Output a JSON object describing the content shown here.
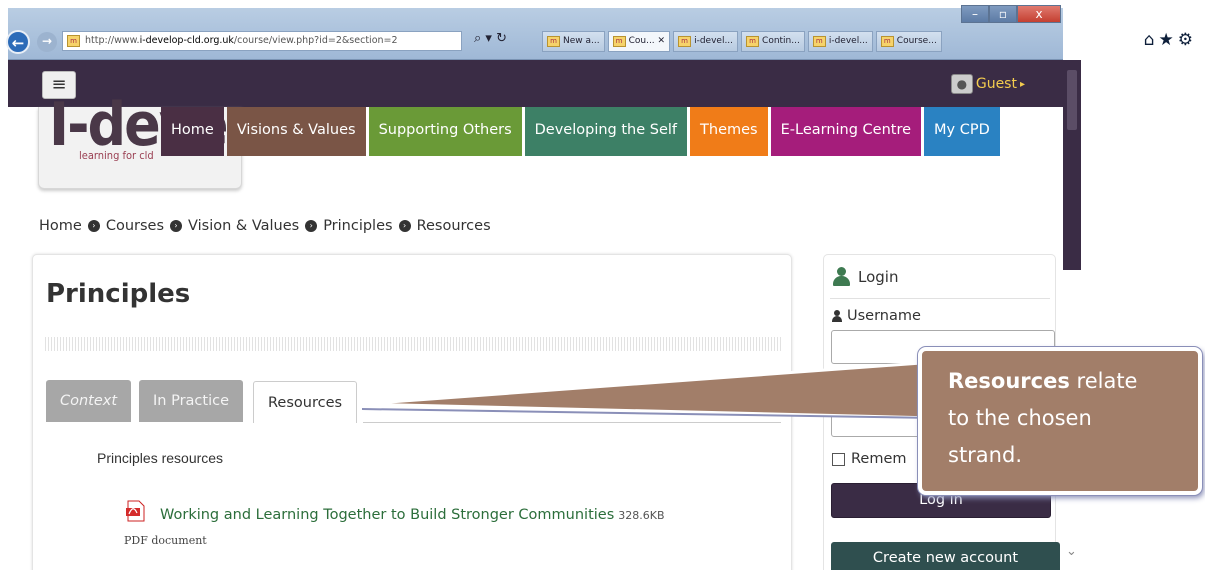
{
  "browser": {
    "url_prefix": "http://www.",
    "url_host": "i-develop-cld.org.uk",
    "url_path": "/course/view.php?id=2&section=2",
    "favicon_text": "m",
    "addr_tools": "⌕ ▾ ↻",
    "tabs": [
      {
        "label": "New a..."
      },
      {
        "label": "Cou... ✕"
      },
      {
        "label": "i-devel..."
      },
      {
        "label": "Contin..."
      },
      {
        "label": "i-devel..."
      },
      {
        "label": "Course..."
      }
    ],
    "icons": [
      "home-icon",
      "star-icon",
      "gear-icon"
    ],
    "icon_glyphs": "⌂★⚙"
  },
  "site": {
    "user": "Guest",
    "user_caret": "▸",
    "logo_main": "I-deve",
    "logo_sub": "learning for cld"
  },
  "menu": [
    {
      "label": "Home",
      "color": "#4a2f44"
    },
    {
      "label": "Visions & Values",
      "color": "#7a5546"
    },
    {
      "label": "Supporting Others",
      "color": "#6a9a37"
    },
    {
      "label": "Developing the Self",
      "color": "#3d8066"
    },
    {
      "label": "Themes",
      "color": "#f07c18"
    },
    {
      "label": "E-Learning Centre",
      "color": "#a51d7b"
    },
    {
      "label": "My CPD",
      "color": "#2a82c2"
    }
  ],
  "breadcrumb": [
    "Home",
    "Courses",
    "Vision & Values",
    "Principles",
    "Resources"
  ],
  "main": {
    "title": "Principles",
    "tabs": [
      "Context",
      "In Practice",
      "Resources"
    ],
    "section_label": "Principles resources",
    "document": {
      "name": "Working and Learning Together to Build Stronger Communities",
      "size": "328.6KB",
      "type": "PDF document"
    }
  },
  "login": {
    "heading": "Login",
    "username_label": "Username",
    "remember_label": "Remem",
    "login_button": "Log in",
    "create_button": "Create new account"
  },
  "callout": {
    "bold": "Resources",
    "rest_line1": " relate",
    "line2": "to the chosen",
    "line3": "strand."
  }
}
